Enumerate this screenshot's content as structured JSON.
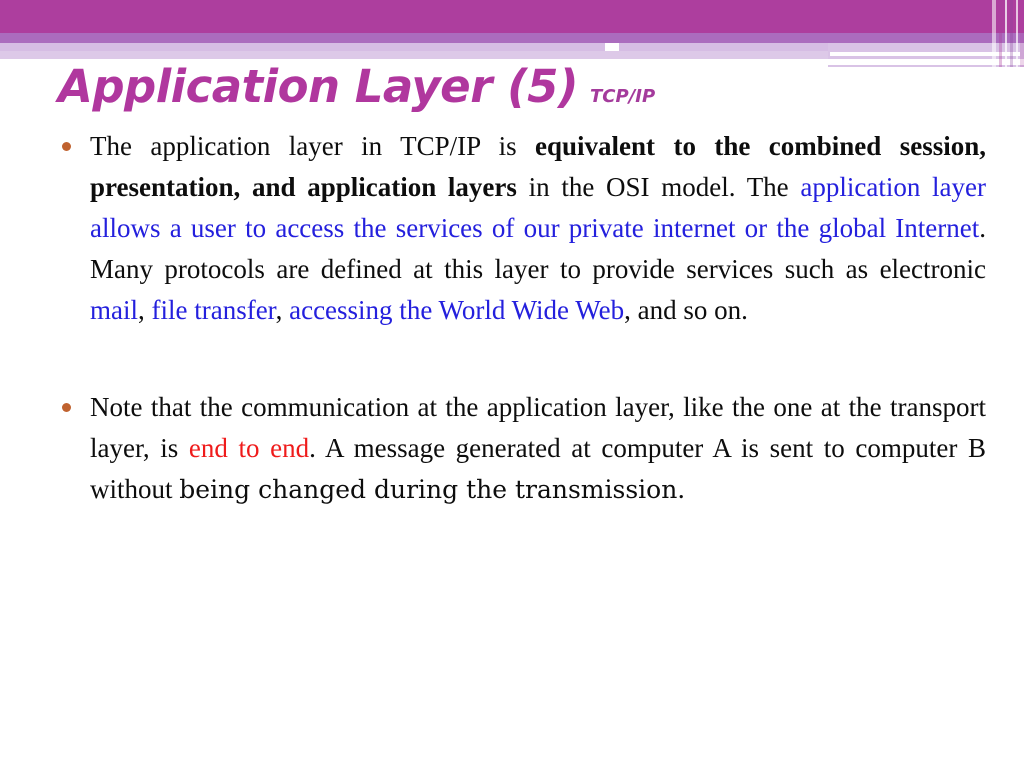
{
  "slide": {
    "title": "Application Layer (5)",
    "subtitle": "TCP/IP",
    "title_color": "#b0379e",
    "bullet_color": "#c0622f",
    "highlight_blue": "#2420dd",
    "highlight_red": "#ef1b1b",
    "header_colors": {
      "magenta": "#ad3e9e",
      "purple": "#ab6cbe",
      "lavender": "#d6bde4"
    },
    "bullets": [
      {
        "id": "bullet-1",
        "runs": [
          {
            "text": "The application layer in TCP/IP is ",
            "style": "normal"
          },
          {
            "text": "equivalent to the combined session, presentation, and application layers",
            "style": "bold"
          },
          {
            "text": " in the OSI model. The ",
            "style": "normal"
          },
          {
            "text": "application layer allows a user to access the services of our private internet or the global Internet",
            "style": "blue"
          },
          {
            "text": ". Many protocols are defined at this layer to provide services such as electronic ",
            "style": "normal"
          },
          {
            "text": "mail",
            "style": "blue"
          },
          {
            "text": ", ",
            "style": "normal"
          },
          {
            "text": "file transfer",
            "style": "blue"
          },
          {
            "text": ", ",
            "style": "normal"
          },
          {
            "text": "accessing the World Wide Web",
            "style": "blue"
          },
          {
            "text": ", and so on.",
            "style": "normal"
          }
        ],
        "plain": "The application layer in TCP/IP is equivalent to the combined session, presentation, and application layers in the OSI model. The application layer allows a user to access the services of our private internet or the global Internet. Many protocols are defined at this layer to provide services such as electronic mail, file transfer, accessing the World Wide Web, and so on."
      },
      {
        "id": "bullet-2",
        "runs": [
          {
            "text": "Note that the communication at the application layer, like the one at the transport layer, is ",
            "style": "normal"
          },
          {
            "text": "end to end",
            "style": "red"
          },
          {
            "text": ". A message generated at computer A is sent to computer B without ",
            "style": "normal"
          },
          {
            "text": "being changed during the transmission.",
            "style": "alt"
          }
        ],
        "plain": "Note that the communication at the application layer, like the one at the transport layer, is end to end. A message generated at computer A is sent to computer B without being changed during the transmission."
      }
    ]
  }
}
